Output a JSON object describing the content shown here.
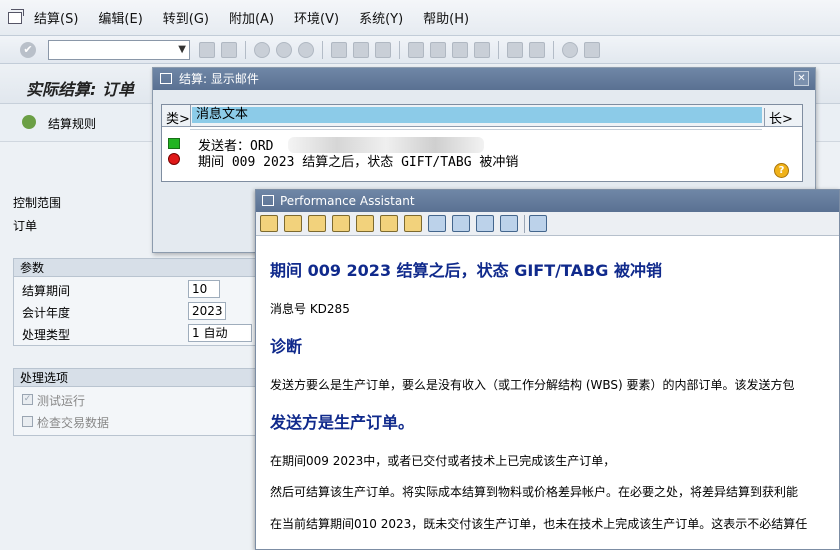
{
  "menu": [
    "结算(S)",
    "编辑(E)",
    "转到(G)",
    "附加(A)",
    "环境(V)",
    "系统(Y)",
    "帮助(H)"
  ],
  "main": {
    "title": "实际结算: 订单",
    "rule_button": "结算规则",
    "control_area_label": "控制范围",
    "order_label": "订单",
    "params_header": "参数",
    "period_label": "结算期间",
    "period_value": "10",
    "fiscal_year_label": "会计年度",
    "fiscal_year_value": "2023",
    "proc_type_label": "处理类型",
    "proc_type_value": "1 自动",
    "options_header": "处理选项",
    "test_run_label": "测试运行",
    "check_trans_label": "检查交易数据"
  },
  "mail_dialog": {
    "title": "结算: 显示邮件",
    "col_type": "类>",
    "col_text": "消息文本",
    "col_long": "长>",
    "row1": "发送者：ORD",
    "row2": "期间 009 2023 结算之后，状态 GIFT/TABG 被冲销",
    "close_glyph": "✕",
    "help_glyph": "?"
  },
  "assistant": {
    "title": "Performance Assistant",
    "heading": "期间  009 2023 结算之后，状态  GIFT/TABG 被冲销",
    "msg_no": "消息号  KD285",
    "diag_title": "诊断",
    "diag_text": "发送方要么是生产订单，要么是没有收入（或工作分解结构 (WBS) 要素）的内部订单。该发送方包",
    "sub_title": "发送方是生产订单。",
    "p1": "在期间009 2023中，或者已交付或者技术上已完成该生产订单，",
    "p2": "然后可结算该生产订单。将实际成本结算到物料或价格差异帐户。在必要之处，将差异结算到获利能",
    "p3": "在当前结算期间010 2023，既未交付该生产订单，也未在技术上完成该生产订单。这表示不必结算任"
  },
  "toolbar": {
    "check_glyph": "✔",
    "dropdown_glyph": "▼"
  },
  "colors": {
    "title_bar": "#6078a0",
    "heading_blue": "#102a8c",
    "selection_blue": "#8ccbe8"
  }
}
